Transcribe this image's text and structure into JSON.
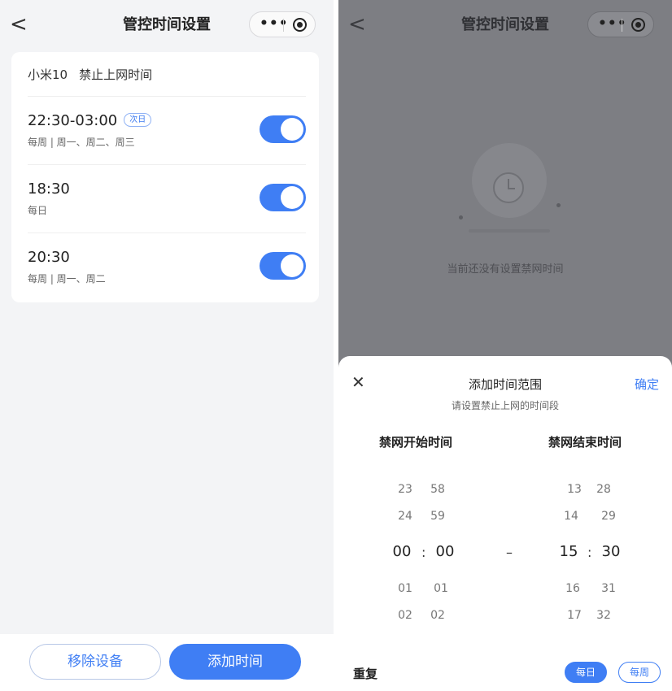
{
  "left": {
    "nav": {
      "back": "<",
      "title": "管控时间设置",
      "more": "•••"
    },
    "card": {
      "device": "小米10",
      "header": "禁止上网时间",
      "rows": [
        {
          "time": "22:30-03:00",
          "badge": "次日",
          "repeat": "每周 | 周一、周二、周三",
          "enabled": true
        },
        {
          "time": "18:30",
          "badge": "",
          "repeat": "每日",
          "enabled": true
        },
        {
          "time": "20:30",
          "badge": "",
          "repeat": "每周 | 周一、周二",
          "enabled": true
        }
      ]
    },
    "buttons": {
      "remove": "移除设备",
      "add": "添加时间"
    }
  },
  "right": {
    "nav": {
      "back": "<",
      "title": "管控时间设置",
      "more": "•••"
    },
    "empty_text": "当前还没有设置禁网时间",
    "sheet": {
      "close": "✕",
      "title": "添加时间范围",
      "confirm": "确定",
      "subtitle": "请设置禁止上网的时间段",
      "start_label": "禁网开始时间",
      "end_label": "禁网结束时间",
      "start_hours": [
        "23",
        "24",
        "00",
        "01",
        "02"
      ],
      "start_minutes": [
        "58",
        "59",
        "00",
        "01",
        "02"
      ],
      "end_hours": [
        "13",
        "14",
        "15",
        "16",
        "17"
      ],
      "end_minutes": [
        "28",
        "29",
        "30",
        "31",
        "32"
      ],
      "colon": ":",
      "dash": "–",
      "repeat_label": "重复",
      "chip_daily": "每日",
      "chip_weekly": "每周"
    }
  },
  "colors": {
    "accent": "#3f7ef4",
    "overlay": "#7d7e83"
  }
}
